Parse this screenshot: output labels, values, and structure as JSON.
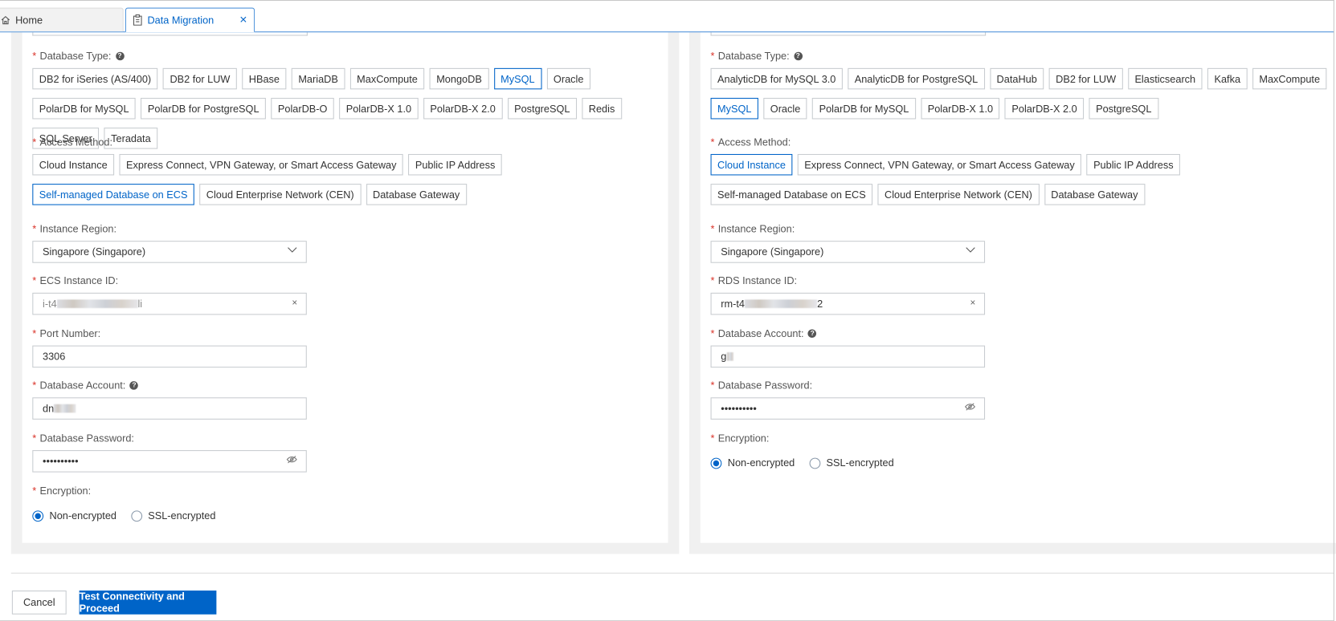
{
  "tabs": [
    {
      "label": "Home",
      "icon": "home-icon"
    },
    {
      "label": "Data Migration",
      "icon": "clipboard-icon",
      "active": true
    }
  ],
  "source": {
    "db_type_label": "Database Type:",
    "db_types": [
      "DB2 for iSeries (AS/400)",
      "DB2 for LUW",
      "HBase",
      "MariaDB",
      "MaxCompute",
      "MongoDB",
      "MySQL",
      "Oracle",
      "PolarDB for MySQL",
      "PolarDB for PostgreSQL",
      "PolarDB-O",
      "PolarDB-X 1.0",
      "PolarDB-X 2.0",
      "PostgreSQL",
      "Redis",
      "SQL Server",
      "Teradata"
    ],
    "db_type_selected": "MySQL",
    "access_label": "Access Method:",
    "access_methods": [
      "Cloud Instance",
      "Express Connect, VPN Gateway, or Smart Access Gateway",
      "Public IP Address",
      "Self-managed Database on ECS",
      "Cloud Enterprise Network (CEN)",
      "Database Gateway"
    ],
    "access_selected": "Self-managed Database on ECS",
    "region_label": "Instance Region:",
    "region_value": "Singapore (Singapore)",
    "instance_label": "ECS Instance ID:",
    "instance_prefix": "i-t4",
    "instance_suffix": "li",
    "port_label": "Port Number:",
    "port_value": "3306",
    "account_label": "Database Account:",
    "account_prefix": "dn",
    "password_label": "Database Password:",
    "password_value": "••••••••••",
    "encryption_label": "Encryption:",
    "encryption_options": [
      "Non-encrypted",
      "SSL-encrypted"
    ],
    "encryption_selected": "Non-encrypted"
  },
  "target": {
    "db_type_label": "Database Type:",
    "db_types": [
      "AnalyticDB for MySQL 3.0",
      "AnalyticDB for PostgreSQL",
      "DataHub",
      "DB2 for LUW",
      "Elasticsearch",
      "Kafka",
      "MaxCompute",
      "MySQL",
      "Oracle",
      "PolarDB for MySQL",
      "PolarDB-X 1.0",
      "PolarDB-X 2.0",
      "PostgreSQL"
    ],
    "db_type_selected": "MySQL",
    "access_label": "Access Method:",
    "access_methods": [
      "Cloud Instance",
      "Express Connect, VPN Gateway, or Smart Access Gateway",
      "Public IP Address",
      "Self-managed Database on ECS",
      "Cloud Enterprise Network (CEN)",
      "Database Gateway"
    ],
    "access_selected": "Cloud Instance",
    "region_label": "Instance Region:",
    "region_value": "Singapore (Singapore)",
    "instance_label": "RDS Instance ID:",
    "instance_prefix": "rm-t4",
    "instance_suffix": "2",
    "account_label": "Database Account:",
    "account_prefix": "g",
    "password_label": "Database Password:",
    "password_value": "••••••••••",
    "encryption_label": "Encryption:",
    "encryption_options": [
      "Non-encrypted",
      "SSL-encrypted"
    ],
    "encryption_selected": "Non-encrypted"
  },
  "footer": {
    "cancel": "Cancel",
    "proceed": "Test Connectivity and Proceed"
  },
  "colors": {
    "accent": "#0064c8",
    "required": "#d93026"
  }
}
